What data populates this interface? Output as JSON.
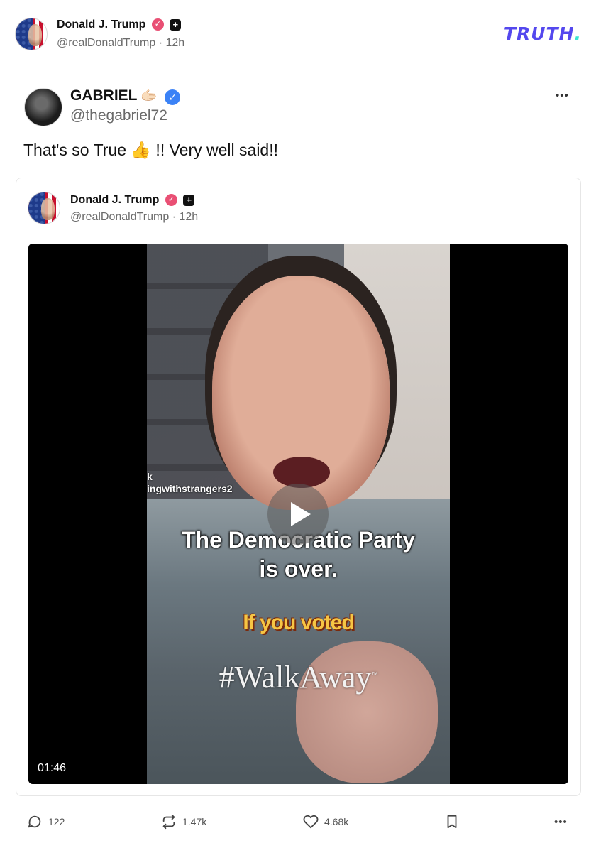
{
  "header": {
    "author_name": "Donald J. Trump",
    "handle": "@realDonaldTrump",
    "separator": "·",
    "time": "12h",
    "brand": "TRUTH",
    "brand_dot": ".",
    "verified_icon": "verified-badge-icon",
    "plus_icon": "plus-badge-icon"
  },
  "retruth": {
    "author_name": "GABRIEL",
    "name_emoji": "🫱🏻",
    "handle": "@thegabriel72",
    "text_before": "That's so True ",
    "text_emoji": "👍",
    "text_after": " !! Very well said!!",
    "more_label": "•••"
  },
  "quoted": {
    "author_name": "Donald J. Trump",
    "handle": "@realDonaldTrump",
    "separator": "·",
    "time": "12h",
    "video": {
      "watermark": "k\ningwithstrangers2",
      "caption_line1": "The Democratic Party",
      "caption_line2": "is over.",
      "caption_yellow": "If you voted",
      "hashtag": "#WalkAway",
      "trademark": "™",
      "duration": "01:46",
      "play_icon": "play-icon"
    }
  },
  "actions": {
    "reply_count": "122",
    "retruth_count": "1.47k",
    "like_count": "4.68k",
    "more_label": "•••"
  },
  "colors": {
    "brand": "#5448ee",
    "brand_dot": "#3ae6d1",
    "verified_pink": "#e94f74",
    "verified_blue": "#3b82f6"
  }
}
